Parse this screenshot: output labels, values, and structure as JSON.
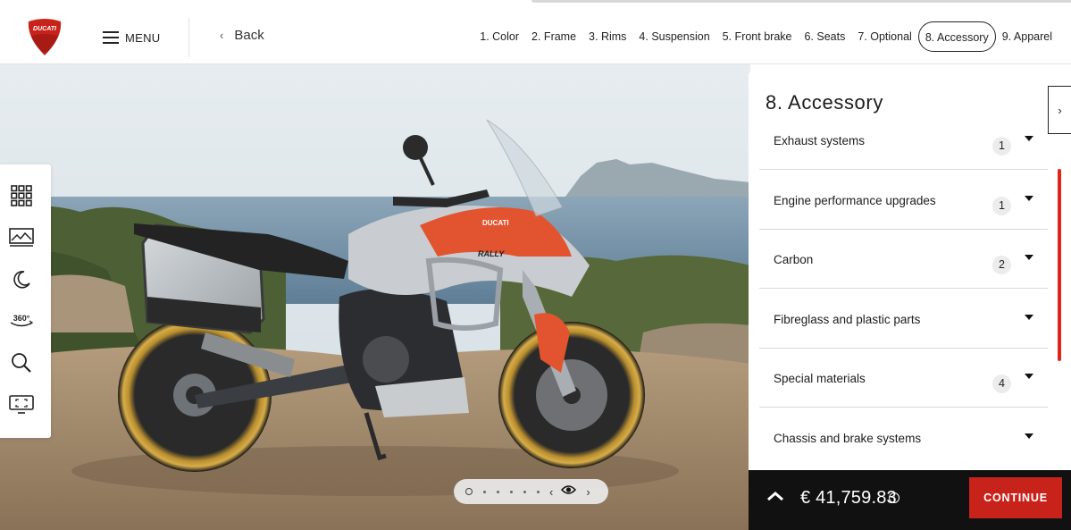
{
  "header": {
    "logo_text": "DUCATI",
    "menu_label": "MENU",
    "back_label": "Back",
    "steps": [
      {
        "label": "1. Color",
        "active": false
      },
      {
        "label": "2. Frame",
        "active": false
      },
      {
        "label": "3. Rims",
        "active": false
      },
      {
        "label": "4. Suspension",
        "active": false
      },
      {
        "label": "5. Front brake",
        "active": false
      },
      {
        "label": "6. Seats",
        "active": false
      },
      {
        "label": "7. Optional",
        "active": false
      },
      {
        "label": "8. Accessory",
        "active": true
      },
      {
        "label": "9. Apparel",
        "active": false
      }
    ]
  },
  "viewer": {
    "tools": [
      "grid-icon",
      "landscape-icon",
      "moon-icon",
      "360-icon",
      "zoom-icon",
      "fullscreen-icon"
    ],
    "tool_360_label": "360°",
    "bike_brand_text": "DUCATI",
    "bike_model_text": "RALLY",
    "pager": {
      "total_dots": 7,
      "active_index": 0
    }
  },
  "panel": {
    "title": "8. Accessory",
    "items": [
      {
        "name": "Exhaust systems",
        "count": "1"
      },
      {
        "name": "Engine performance upgrades",
        "count": "1"
      },
      {
        "name": "Carbon",
        "count": "2"
      },
      {
        "name": "Fibreglass and plastic parts",
        "count": ""
      },
      {
        "name": "Special materials",
        "count": "4"
      },
      {
        "name": "Chassis and brake systems",
        "count": ""
      }
    ]
  },
  "footer": {
    "price": "€ 41,759.83",
    "info_glyph": "i",
    "continue_label": "CONTINUE"
  },
  "colors": {
    "brand_red": "#c8231b",
    "scroll_red": "#e0261b",
    "price_bar": "#111111"
  }
}
